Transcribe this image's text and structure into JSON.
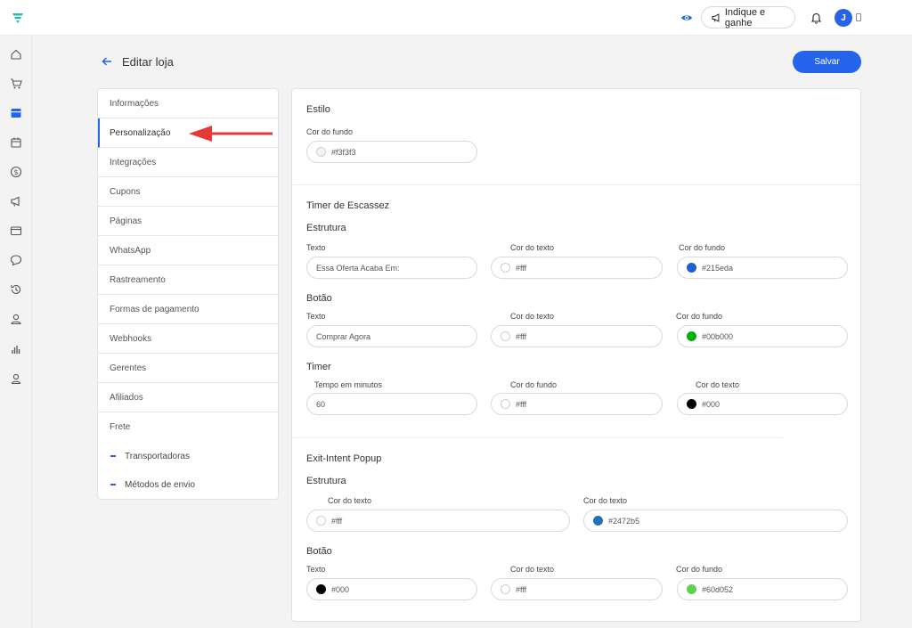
{
  "topbar": {
    "indique_label": "Indique e ganhe",
    "avatar_initial": "J"
  },
  "header": {
    "title": "Editar loja",
    "save_label": "Salvar"
  },
  "nav": {
    "items": [
      "Informações",
      "Personalização",
      "Integrações",
      "Cupons",
      "Páginas",
      "WhatsApp",
      "Rastreamento",
      "Formas de pagamento",
      "Webhooks",
      "Gerentes",
      "Afiliados",
      "Frete"
    ],
    "active_index": 1,
    "sub_items": [
      "Transportadoras",
      "Métodos de envio"
    ]
  },
  "estilo": {
    "title": "Estilo",
    "cor_fundo_label": "Cor do fundo",
    "cor_fundo_value": "#f3f3f3"
  },
  "timer": {
    "title": "Timer de Escassez",
    "estrutura": {
      "title": "Estrutura",
      "texto_label": "Texto",
      "texto_value": "Essa Oferta Acaba Em:",
      "cor_texto_label": "Cor do texto",
      "cor_texto_value": "#fff",
      "cor_fundo_label": "Cor do fundo",
      "cor_fundo_value": "#215eda"
    },
    "botao": {
      "title": "Botão",
      "texto_label": "Texto",
      "texto_value": "Comprar Agora",
      "cor_texto_label": "Cor do texto",
      "cor_texto_value": "#fff",
      "cor_fundo_label": "Cor do fundo",
      "cor_fundo_value": "#00b000"
    },
    "timer": {
      "title": "Timer",
      "tempo_label": "Tempo em minutos",
      "tempo_value": "60",
      "cor_fundo_label": "Cor do fundo",
      "cor_fundo_value": "#fff",
      "cor_texto_label": "Cor do texto",
      "cor_texto_value": "#000"
    }
  },
  "popup": {
    "title": "Exit-Intent Popup",
    "estrutura": {
      "title": "Estrutura",
      "cor_texto_label_1": "Cor do texto",
      "cor_texto_value_1": "#fff",
      "cor_texto_label_2": "Cor do texto",
      "cor_texto_value_2": "#2472b5"
    },
    "botao": {
      "title": "Botão",
      "texto_label": "Texto",
      "texto_value": "#000",
      "cor_texto_label": "Cor do texto",
      "cor_texto_value": "#fff",
      "cor_fundo_label": "Cor do fundo",
      "cor_fundo_value": "#60d052"
    }
  },
  "colors": {
    "accent": "#2563eb",
    "annotation_arrow": "#e53935",
    "swatch_timer_estrutura_fundo": "#215eda",
    "swatch_timer_botao_fundo": "#00b000",
    "swatch_timer_texto": "#000000",
    "swatch_popup_estrutura_texto": "#2472b5",
    "swatch_popup_botao_texto": "#000000",
    "swatch_popup_botao_fundo": "#60d052"
  }
}
